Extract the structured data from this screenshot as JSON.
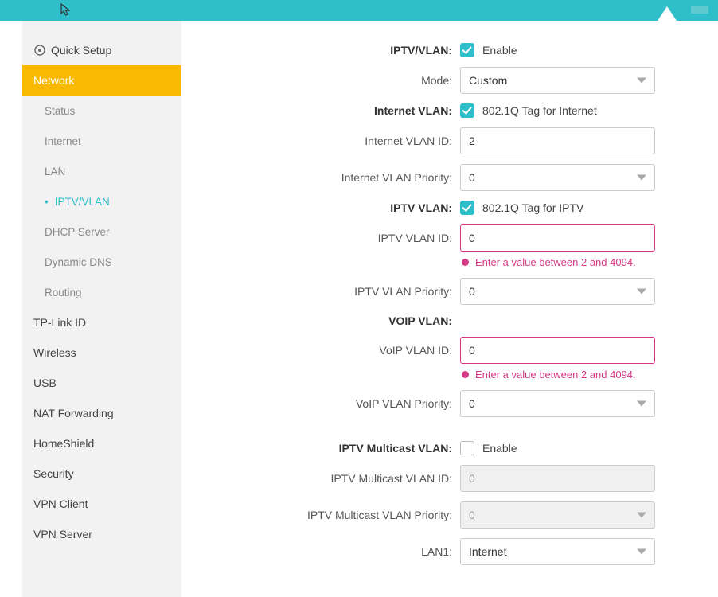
{
  "sidebar": {
    "quick_setup": "Quick Setup",
    "network": "Network",
    "sub": {
      "status": "Status",
      "internet": "Internet",
      "lan": "LAN",
      "iptv_vlan": "IPTV/VLAN",
      "dhcp": "DHCP Server",
      "ddns": "Dynamic DNS",
      "routing": "Routing"
    },
    "tplink_id": "TP-Link ID",
    "wireless": "Wireless",
    "usb": "USB",
    "nat": "NAT Forwarding",
    "homeshield": "HomeShield",
    "security": "Security",
    "vpn_client": "VPN Client",
    "vpn_server": "VPN Server"
  },
  "form": {
    "iptv_vlan": {
      "label": "IPTV/VLAN:",
      "enable": "Enable"
    },
    "mode": {
      "label": "Mode:",
      "value": "Custom"
    },
    "internet_vlan": {
      "label": "Internet VLAN:",
      "tag": "802.1Q Tag for Internet"
    },
    "internet_vlan_id": {
      "label": "Internet VLAN ID:",
      "value": "2"
    },
    "internet_vlan_priority": {
      "label": "Internet VLAN Priority:",
      "value": "0"
    },
    "iptv_vlan_section": {
      "label": "IPTV VLAN:",
      "tag": "802.1Q Tag for IPTV"
    },
    "iptv_vlan_id": {
      "label": "IPTV VLAN ID:",
      "value": "0",
      "error": "Enter a value between 2 and 4094."
    },
    "iptv_vlan_priority": {
      "label": "IPTV VLAN Priority:",
      "value": "0"
    },
    "voip_vlan": {
      "label": "VOIP VLAN:"
    },
    "voip_vlan_id": {
      "label": "VoIP VLAN ID:",
      "value": "0",
      "error": "Enter a value between 2 and 4094."
    },
    "voip_vlan_priority": {
      "label": "VoIP VLAN Priority:",
      "value": "0"
    },
    "iptv_multicast": {
      "label": "IPTV Multicast VLAN:",
      "enable": "Enable"
    },
    "iptv_multicast_id": {
      "label": "IPTV Multicast VLAN ID:",
      "value": "0"
    },
    "iptv_multicast_priority": {
      "label": "IPTV Multicast VLAN Priority:",
      "value": "0"
    },
    "lan1": {
      "label": "LAN1:",
      "value": "Internet"
    }
  }
}
